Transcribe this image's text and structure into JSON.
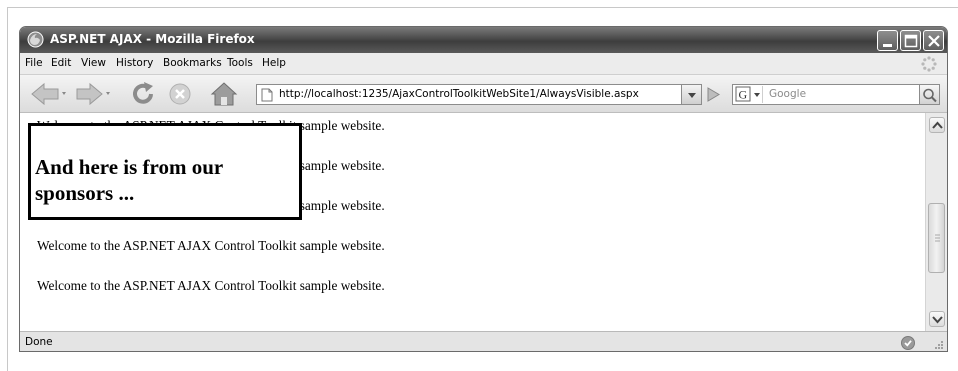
{
  "window": {
    "title": "ASP.NET AJAX - Mozilla Firefox"
  },
  "menubar": {
    "items": [
      "File",
      "Edit",
      "View",
      "History",
      "Bookmarks",
      "Tools",
      "Help"
    ]
  },
  "navbar": {
    "url": "http://localhost:1235/AjaxControlToolkitWebSite1/AlwaysVisible.aspx",
    "search_placeholder": "Google"
  },
  "content": {
    "welcome_lines": [
      "Welcome to the ASP.NET AJAX Control Toolkit sample website.",
      "Welcome to the ASP.NET AJAX Control Toolkit sample website.",
      "Welcome to the ASP.NET AJAX Control Toolkit sample website.",
      "Welcome to the ASP.NET AJAX Control Toolkit sample website.",
      "Welcome to the ASP.NET AJAX Control Toolkit sample website."
    ],
    "ad_panel_text": "And here is from our sponsors ..."
  },
  "statusbar": {
    "text": "Done"
  },
  "icons": {
    "app": "firefox-icon",
    "minimize": "minimize-icon",
    "maximize": "maximize-icon",
    "close": "close-icon",
    "back": "back-arrow-icon",
    "forward": "forward-arrow-icon",
    "reload": "reload-icon",
    "stop": "stop-icon",
    "home": "home-icon",
    "page": "page-icon",
    "go": "go-arrow-icon",
    "search": "magnifier-icon"
  }
}
